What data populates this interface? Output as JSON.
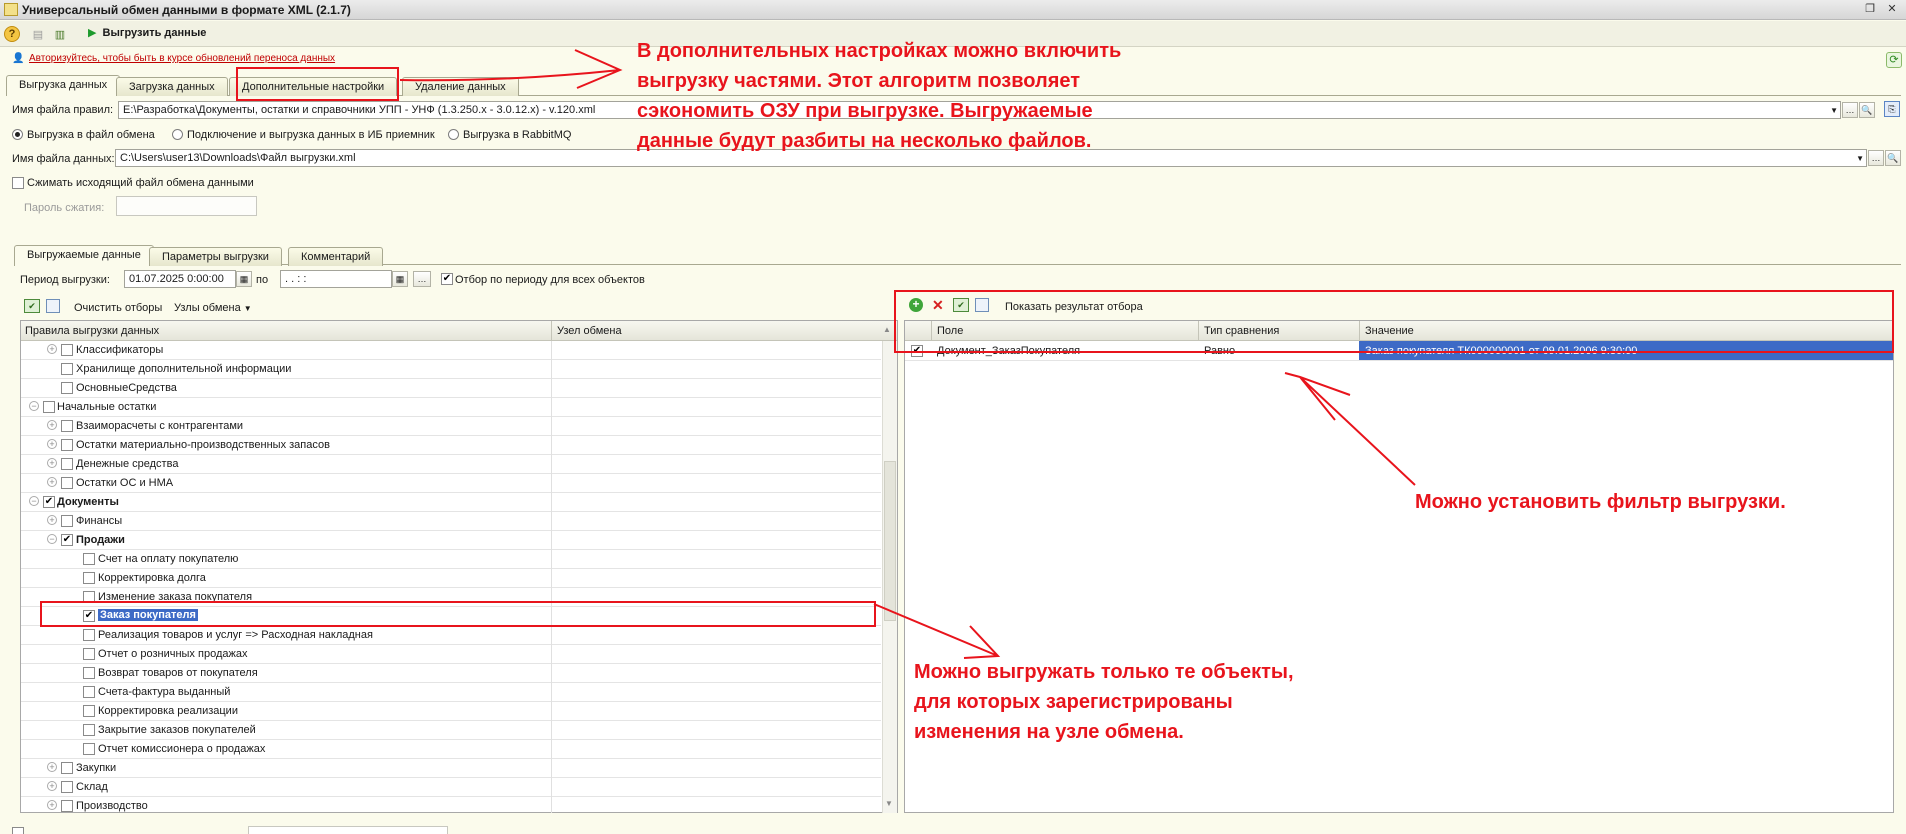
{
  "window": {
    "title": "Универсальный обмен данными в формате XML (2.1.7)"
  },
  "toolbar": {
    "export_label": "Выгрузить данные"
  },
  "auth_link": "Авторизуйтесь, чтобы быть в курсе обновлений переноса данных",
  "main_tabs": [
    "Выгрузка данных",
    "Загрузка данных",
    "Дополнительные настройки",
    "Удаление данных"
  ],
  "rules_file": {
    "label": "Имя файла правил:",
    "value": "E:\\Разработка\\Документы, остатки и справочники УПП - УНФ (1.3.250.x - 3.0.12.x) - v.120.xml"
  },
  "export_modes": [
    "Выгрузка в файл обмена",
    "Подключение и выгрузка данных в ИБ приемник",
    "Выгрузка в RabbitMQ"
  ],
  "data_file": {
    "label": "Имя файла данных:",
    "value": "C:\\Users\\user13\\Downloads\\Файл выгрузки.xml"
  },
  "compress": {
    "label": "Сжимать исходящий файл обмена данными"
  },
  "password": {
    "label": "Пароль сжатия:"
  },
  "inner_tabs": [
    "Выгружаемые данные",
    "Параметры выгрузки",
    "Комментарий"
  ],
  "period": {
    "label": "Период выгрузки:",
    "from": "01.07.2025  0:00:00",
    "to_label": "по",
    "to": " .  .      :  :",
    "filter_all_label": "Отбор по периоду для всех объектов"
  },
  "left_toolbar": {
    "clear": "Очистить отборы",
    "nodes": "Узлы обмена"
  },
  "rules_table": {
    "columns": [
      "Правила выгрузки данных",
      "Узел обмена"
    ],
    "rows": [
      {
        "label": "Классификаторы",
        "level": 2,
        "expander": "+",
        "checked": false,
        "bold": false
      },
      {
        "label": "Хранилище дополнительной информации",
        "level": 2,
        "expander": "",
        "checked": false,
        "bold": false
      },
      {
        "label": "ОсновныеСредства",
        "level": 2,
        "expander": "",
        "checked": false,
        "bold": false
      },
      {
        "label": "Начальные остатки",
        "level": 1,
        "expander": "-",
        "checked": false,
        "bold": false
      },
      {
        "label": "Взаиморасчеты с контрагентами",
        "level": 2,
        "expander": "+",
        "checked": false,
        "bold": false
      },
      {
        "label": "Остатки материально-производственных запасов",
        "level": 2,
        "expander": "+",
        "checked": false,
        "bold": false
      },
      {
        "label": "Денежные средства",
        "level": 2,
        "expander": "+",
        "checked": false,
        "bold": false
      },
      {
        "label": "Остатки ОС и НМА",
        "level": 2,
        "expander": "+",
        "checked": false,
        "bold": false
      },
      {
        "label": "Документы",
        "level": 1,
        "expander": "-",
        "checked": true,
        "bold": true
      },
      {
        "label": "Финансы",
        "level": 2,
        "expander": "+",
        "checked": false,
        "bold": false
      },
      {
        "label": "Продажи",
        "level": 2,
        "expander": "-",
        "checked": true,
        "bold": true
      },
      {
        "label": "Счет на оплату покупателю",
        "level": 3,
        "expander": "",
        "checked": false,
        "bold": false
      },
      {
        "label": "Корректировка долга",
        "level": 3,
        "expander": "",
        "checked": false,
        "bold": false
      },
      {
        "label": "Изменение заказа покупателя",
        "level": 3,
        "expander": "",
        "checked": false,
        "bold": false
      },
      {
        "label": "Заказ покупателя",
        "level": 3,
        "expander": "",
        "checked": true,
        "bold": true,
        "selected": true
      },
      {
        "label": "Реализация товаров и услуг => Расходная накладная",
        "level": 3,
        "expander": "",
        "checked": false,
        "bold": false
      },
      {
        "label": "Отчет о розничных продажах",
        "level": 3,
        "expander": "",
        "checked": false,
        "bold": false
      },
      {
        "label": "Возврат товаров от покупателя",
        "level": 3,
        "expander": "",
        "checked": false,
        "bold": false
      },
      {
        "label": "Счета-фактура выданный",
        "level": 3,
        "expander": "",
        "checked": false,
        "bold": false
      },
      {
        "label": "Корректировка реализации",
        "level": 3,
        "expander": "",
        "checked": false,
        "bold": false
      },
      {
        "label": "Закрытие заказов покупателей",
        "level": 3,
        "expander": "",
        "checked": false,
        "bold": false
      },
      {
        "label": "Отчет комиссионера о продажах",
        "level": 3,
        "expander": "",
        "checked": false,
        "bold": false
      },
      {
        "label": "Закупки",
        "level": 2,
        "expander": "+",
        "checked": false,
        "bold": false
      },
      {
        "label": "Склад",
        "level": 2,
        "expander": "+",
        "checked": false,
        "bold": false
      },
      {
        "label": "Производство",
        "level": 2,
        "expander": "+",
        "checked": false,
        "bold": false
      }
    ]
  },
  "filter_panel": {
    "show_result": "Показать результат отбора",
    "columns": [
      "Поле",
      "Тип сравнения",
      "Значение"
    ],
    "rows": [
      {
        "checked": true,
        "field": "Документ_ЗаказПокупателя",
        "comparison": "Равно",
        "value": "Заказ покупателя ТК000000001 от 09.01.2006 9:30:00"
      }
    ]
  },
  "annotations": {
    "top": [
      "В дополнительных настройках можно включить",
      "выгрузку частями. Этот алгоритм позволяет",
      "сэкономить ОЗУ при выгрузке. Выгружаемые",
      "данные будут разбиты на несколько файлов."
    ],
    "filter": "Можно установить фильтр выгрузки.",
    "node": [
      "Можно выгружать только те объекты,",
      "для которых зарегистрированы",
      "изменения на узле обмена."
    ]
  },
  "colors": {
    "annotation": "#e8141c",
    "selection": "#3d6ac6",
    "link": "#c00000"
  }
}
